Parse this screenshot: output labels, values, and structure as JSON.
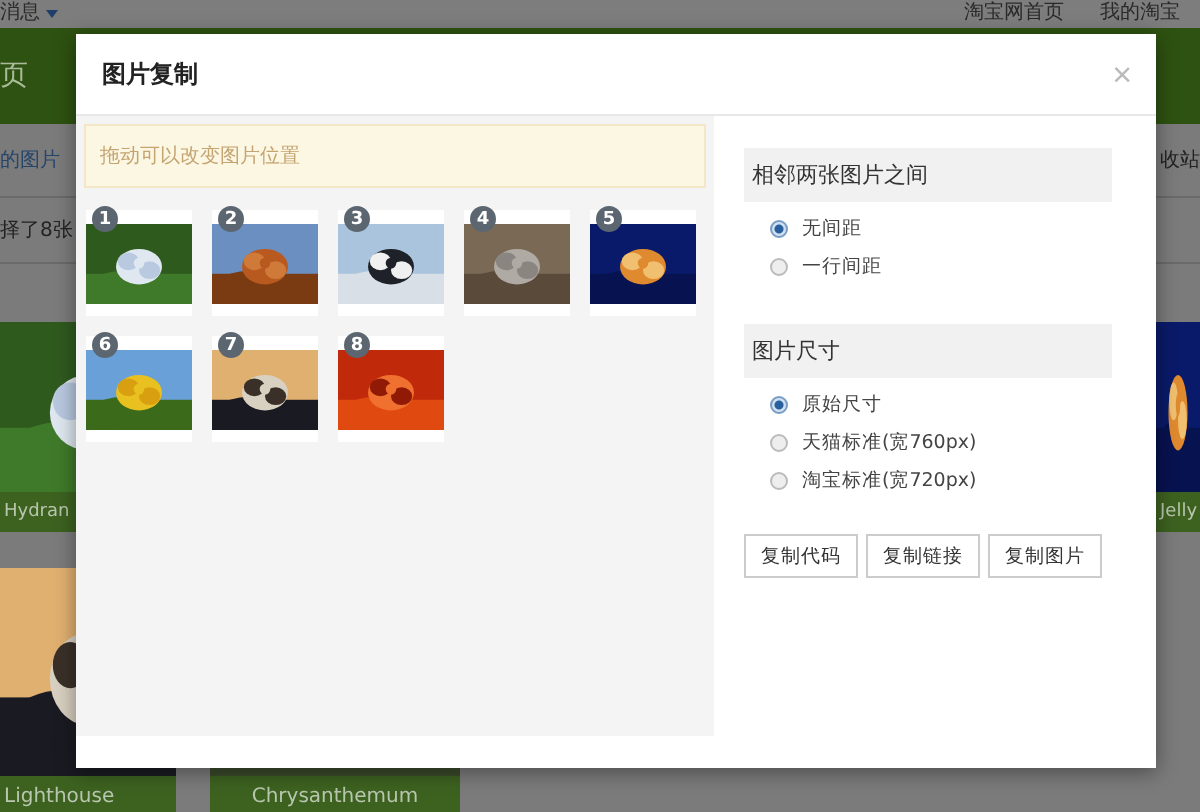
{
  "page": {
    "top_links_left": "消息",
    "top_links_right": [
      "淘宝网首页",
      "我的淘宝"
    ],
    "nav_text": "页",
    "side_link": "的图片",
    "side_note": "择了8张",
    "right_link": "收站",
    "tiles": [
      {
        "caption": "Hydran"
      },
      {
        "caption": "Jelly"
      },
      {
        "caption": "Lighthouse"
      },
      {
        "caption": "Chrysanthemum"
      }
    ]
  },
  "dialog": {
    "title": "图片复制",
    "close": "×",
    "notice": "拖动可以改变图片位置",
    "thumbnails": [
      {
        "number": "1"
      },
      {
        "number": "2"
      },
      {
        "number": "3"
      },
      {
        "number": "4"
      },
      {
        "number": "5"
      },
      {
        "number": "6"
      },
      {
        "number": "7"
      },
      {
        "number": "8"
      }
    ],
    "sections": [
      {
        "heading": "相邻两张图片之间",
        "options": [
          {
            "label": "无间距",
            "selected": true
          },
          {
            "label": "一行间距",
            "selected": false
          }
        ]
      },
      {
        "heading": "图片尺寸",
        "options": [
          {
            "label": "原始尺寸",
            "selected": true
          },
          {
            "label": "天猫标准(宽760px)",
            "selected": false
          },
          {
            "label": "淘宝标准(宽720px)",
            "selected": false
          }
        ]
      }
    ],
    "buttons": [
      "复制代码",
      "复制链接",
      "复制图片"
    ]
  }
}
